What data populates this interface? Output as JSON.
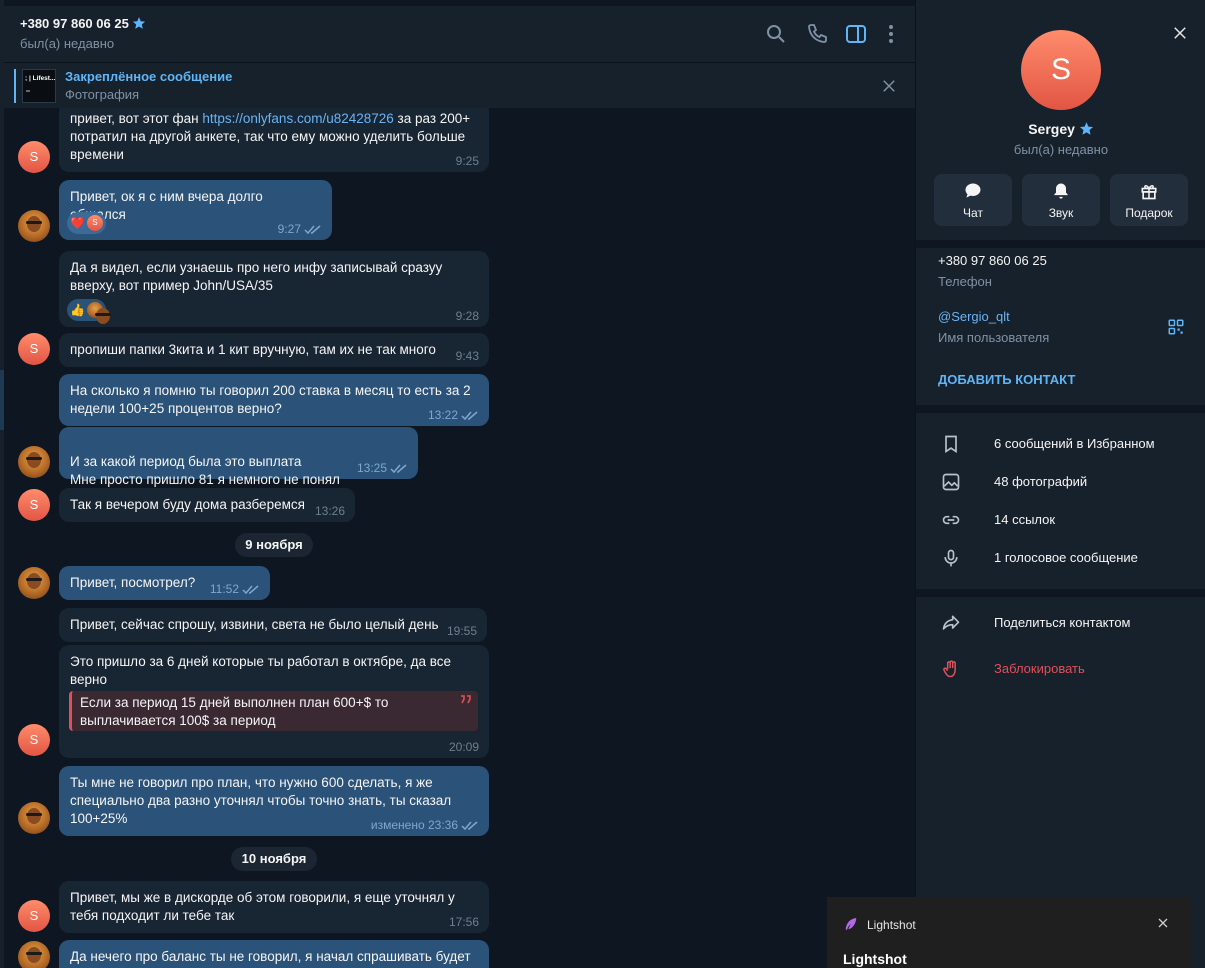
{
  "chat": {
    "contact_name": "+380 97 860 06 25",
    "status": "был(а) недавно",
    "pinned": {
      "title": "Закреплённое сообщение",
      "subtitle": "Фотография",
      "thumb_text": "; | Lifest..."
    },
    "dates": [
      "9 ноября",
      "10 ноября"
    ],
    "messages": [
      {
        "from": "Sergey",
        "avatar": "S",
        "text_pre": "привет,  вот этот фан ",
        "link": "https://onlyfans.com/u82428726",
        "text_post": " за раз 200+ потратил на другой анкете, так что ему можно уделить больше времени",
        "time": "9:25"
      },
      {
        "from": "me",
        "text": "Привет, ок я с ним вчера долго общался",
        "time": "9:27",
        "reaction": "❤️"
      },
      {
        "from": "Sergey",
        "text": "Да я видел, если узнаешь про него инфу записывай сразуу вверху, вот пример  John/USA/35",
        "time": "9:28",
        "reaction": "👍"
      },
      {
        "from": "Sergey",
        "avatar": "S",
        "text": "пропиши папки 3кита и 1 кит вручную, там их не так много",
        "time": "9:43"
      },
      {
        "from": "me",
        "text": "На сколько я помню ты говорил 200 ставка в месяц то есть за 2 недели 100+25 процентов верно?",
        "time": "13:22"
      },
      {
        "from": "me",
        "text": "И за какой период была это выплата\nМне просто пришло 81 я немного не понял",
        "time": "13:25"
      },
      {
        "from": "Sergey",
        "avatar": "S",
        "text": "Так я вечером буду дома разберемся",
        "time": "13:26"
      },
      {
        "from": "me",
        "text": "Привет, посмотрел?",
        "time": "11:52"
      },
      {
        "from": "Sergey",
        "text": "Привет, сейчас спрошу, извини, света не было целый день",
        "time": "19:55"
      },
      {
        "from": "Sergey",
        "avatar": "S",
        "text": "Это пришло за 6 дней которые ты работал в октябре, да все верно",
        "quote": "Если за период 15 дней выполнен план 600+$ то выплачивается 100$ за период",
        "time": "20:09"
      },
      {
        "from": "me",
        "text": "Ты мне не говорил про план, что нужно 600 сделать, я же специально два разно уточнял чтобы точно знать, ты сказал 100+25%",
        "time": "изменено 23:36"
      },
      {
        "from": "Sergey",
        "avatar": "S",
        "text": "Привет, мы же в дискорде об этом говорили, я еще уточнял у тебя подходит ли тебе так",
        "time": "17:56"
      },
      {
        "from": "me",
        "text": "Да нечего про баланс ты не говорил, я начал спрашивать будет",
        "time": ""
      }
    ]
  },
  "profile": {
    "avatar_letter": "S",
    "name": "Sergey",
    "status": "был(а) недавно",
    "buttons": [
      {
        "label": "Чат",
        "icon": "chat-icon"
      },
      {
        "label": "Звук",
        "icon": "bell-icon"
      },
      {
        "label": "Подарок",
        "icon": "gift-icon"
      }
    ],
    "phone": "+380 97 860 06 25",
    "phone_label": "Телефон",
    "username": "@Sergio_qlt",
    "username_label": "Имя пользователя",
    "add_contact": "ДОБАВИТЬ КОНТАКТ",
    "media": [
      {
        "label": "6 сообщений в Избранном",
        "icon": "bookmark-icon"
      },
      {
        "label": "48 фотографий",
        "icon": "photo-icon"
      },
      {
        "label": "14 ссылок",
        "icon": "link-icon"
      },
      {
        "label": "1 голосовое сообщение",
        "icon": "mic-icon"
      }
    ],
    "share": "Поделиться контактом",
    "block": "Заблокировать"
  },
  "toast": {
    "app": "Lightshot",
    "title": "Lightshot"
  },
  "colors": {
    "accent": "#5eb5f7",
    "danger": "#e0505a",
    "bubble_in": "#182533",
    "bubble_out": "#2b5278"
  }
}
